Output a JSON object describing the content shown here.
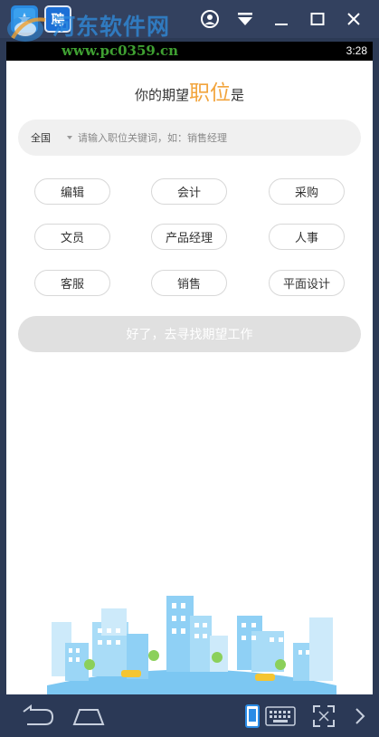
{
  "watermark": {
    "title": "河东软件网",
    "url": "www.pc0359.cn"
  },
  "app_tabs": [
    {
      "icon": "star-app-icon"
    },
    {
      "icon": "recruit-app-icon",
      "glyph": "聘"
    }
  ],
  "status_bar": {
    "time": "3:28"
  },
  "page": {
    "heading_prefix": "你的期望",
    "heading_highlight": "职位",
    "heading_suffix": "是",
    "highlight_color": "#f2a43c"
  },
  "search": {
    "region": "全国",
    "placeholder": "请输入职位关键词，如：销售经理"
  },
  "job_options": [
    "编辑",
    "会计",
    "采购",
    "文员",
    "产品经理",
    "人事",
    "客服",
    "销售",
    "平面设计"
  ],
  "cta": {
    "label": "好了，去寻找期望工作",
    "state": "disabled"
  },
  "colors": {
    "emulator_chrome": "#33415f",
    "sky_blue": "#8fd0f5",
    "accent_orange": "#f2a43c"
  }
}
